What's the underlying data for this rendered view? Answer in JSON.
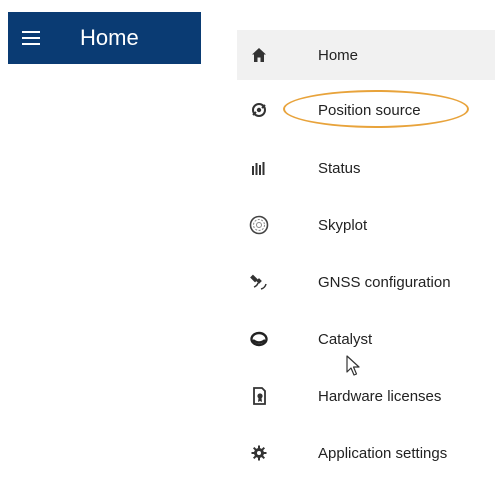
{
  "appbar": {
    "title": "Home",
    "menu_icon": "hamburger-menu-icon",
    "background": "#0a3b73"
  },
  "drawer": {
    "items": [
      {
        "label": "Home",
        "icon": "home-icon",
        "selected": true
      },
      {
        "label": "Position source",
        "icon": "position-source-icon",
        "selected": false
      },
      {
        "label": "Status",
        "icon": "status-bars-icon",
        "selected": false
      },
      {
        "label": "Skyplot",
        "icon": "skyplot-icon",
        "selected": false
      },
      {
        "label": "GNSS configuration",
        "icon": "satellite-icon",
        "selected": false
      },
      {
        "label": "Catalyst",
        "icon": "catalyst-icon",
        "selected": false
      },
      {
        "label": "Hardware licenses",
        "icon": "license-icon",
        "selected": false
      },
      {
        "label": "Application settings",
        "icon": "gear-icon",
        "selected": false
      }
    ]
  },
  "annotation": {
    "highlight_color": "#e8a33b",
    "highlighted_item": "Position source"
  }
}
